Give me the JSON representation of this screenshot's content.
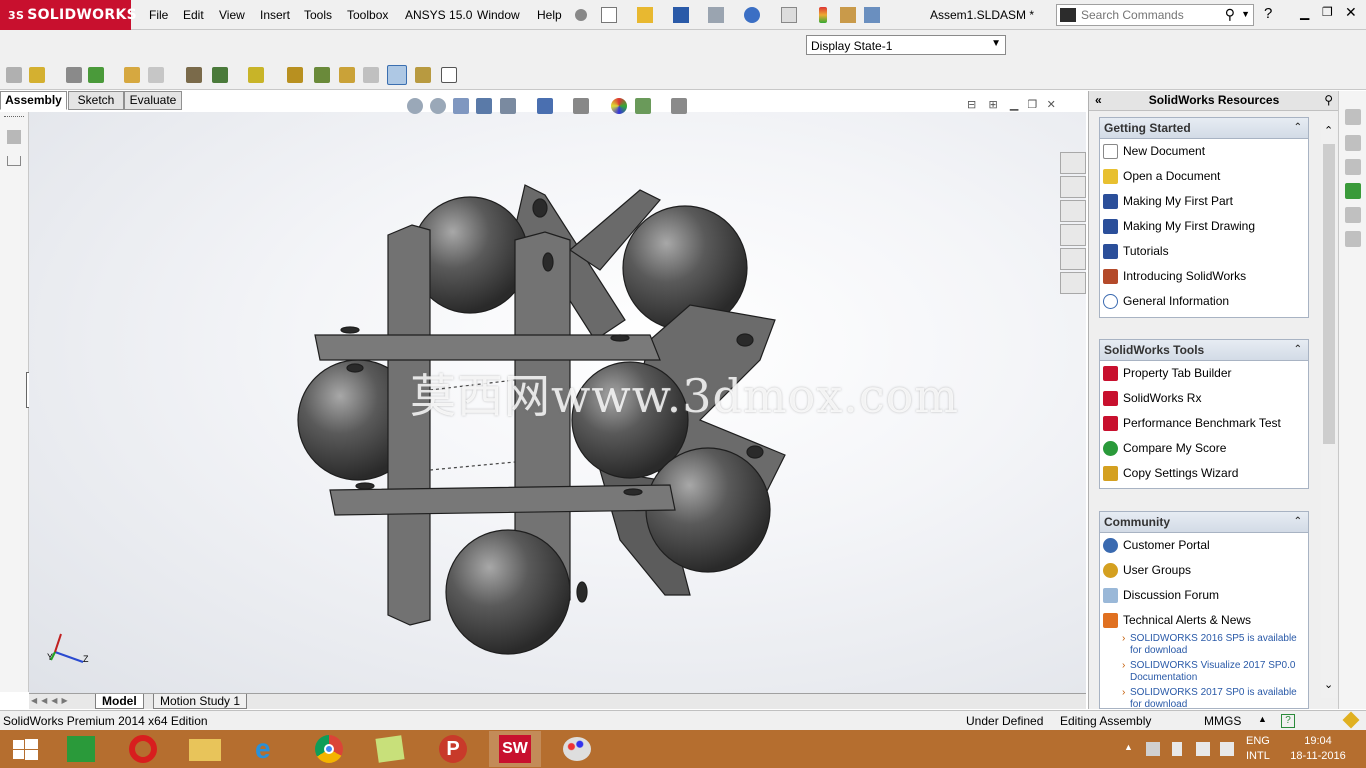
{
  "app": {
    "brand": "SOLIDWORKS",
    "doc_title": "Assem1.SLDASM *"
  },
  "menu": [
    "File",
    "Edit",
    "View",
    "Insert",
    "Tools",
    "Toolbox",
    "ANSYS 15.0",
    "Window",
    "Help"
  ],
  "search": {
    "placeholder": "Search Commands"
  },
  "display_state": "Display State-1",
  "command_tabs": [
    "Assembly",
    "Sketch",
    "Evaluate"
  ],
  "watermark": "莫西网www.3dmox.com",
  "bottom_tabs": [
    "Model",
    "Motion Study 1"
  ],
  "status": {
    "edition": "SolidWorks Premium 2014 x64 Edition",
    "state": "Under Defined",
    "mode": "Editing Assembly",
    "units": "MMGS"
  },
  "taskpane": {
    "title": "SolidWorks Resources",
    "getting_started": {
      "title": "Getting Started",
      "items": [
        "New Document",
        "Open a Document",
        "Making My First Part",
        "Making My First Drawing",
        "Tutorials",
        "Introducing SolidWorks",
        "General Information"
      ]
    },
    "tools": {
      "title": "SolidWorks Tools",
      "items": [
        "Property Tab Builder",
        "SolidWorks Rx",
        "Performance Benchmark Test",
        "Compare My Score",
        "Copy Settings Wizard"
      ]
    },
    "community": {
      "title": "Community",
      "items": [
        "Customer Portal",
        "User Groups",
        "Discussion Forum",
        "Technical Alerts & News"
      ],
      "news": [
        "SOLIDWORKS 2016 SP5 is available for download",
        "SOLIDWORKS Visualize 2017 SP0.0 Documentation",
        "SOLIDWORKS 2017 SP0 is available for download"
      ]
    }
  },
  "tray": {
    "lang1": "ENG",
    "lang2": "INTL",
    "time": "19:04",
    "date": "18-11-2016"
  },
  "colors": {
    "brand": "#c8102e",
    "taskbar": "#b56e2f",
    "part": "#5e5e5e"
  }
}
